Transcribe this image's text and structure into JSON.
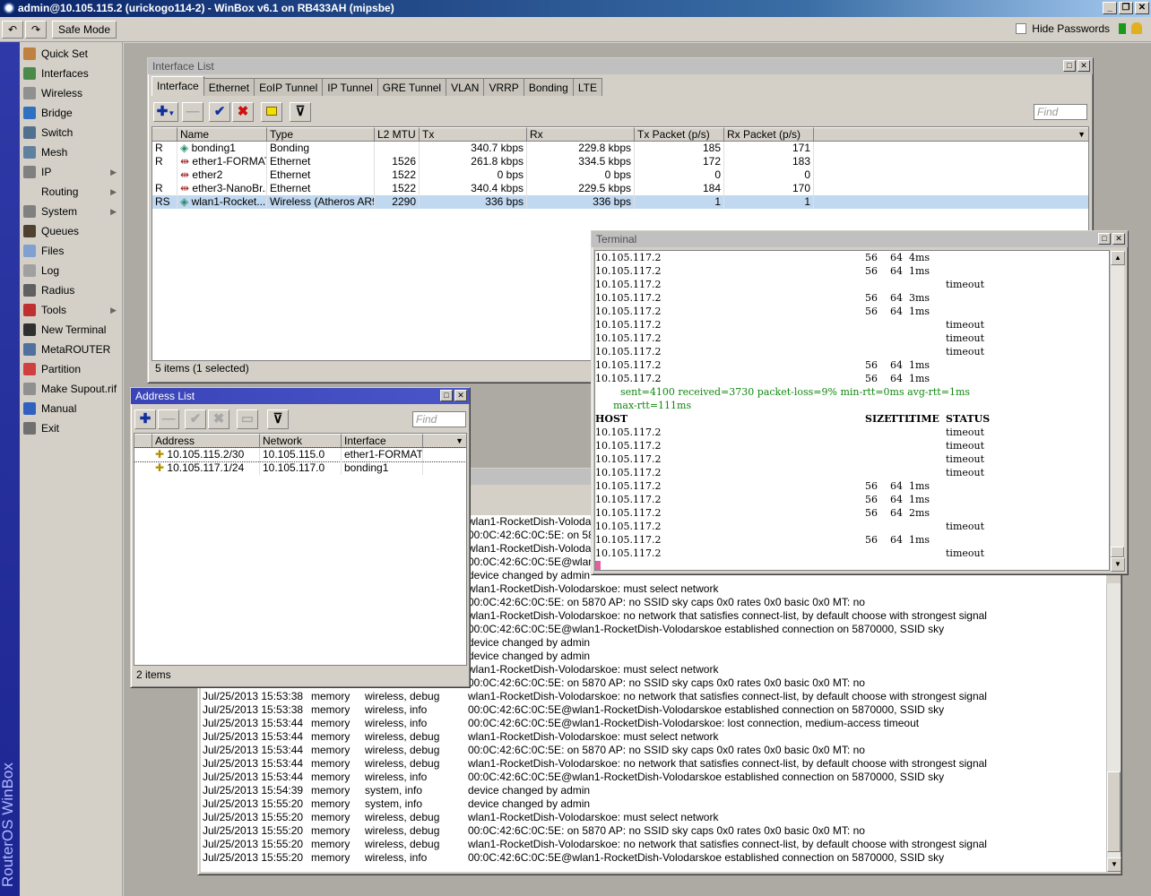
{
  "app": {
    "title": "admin@10.105.115.2 (urickogo114-2) - WinBox v6.1 on RB433AH (mipsbe)",
    "safe_mode": "Safe Mode",
    "hide_passwords": "Hide Passwords",
    "brand": "RouterOS WinBox"
  },
  "menu": [
    {
      "label": "Quick Set",
      "icon": "quick-set-icon",
      "color": "#c08040",
      "arrow": false
    },
    {
      "label": "Interfaces",
      "icon": "interfaces-icon",
      "color": "#4a8a4a",
      "arrow": false
    },
    {
      "label": "Wireless",
      "icon": "wireless-icon",
      "color": "#909090",
      "arrow": false
    },
    {
      "label": "Bridge",
      "icon": "bridge-icon",
      "color": "#3070c0",
      "arrow": false
    },
    {
      "label": "Switch",
      "icon": "switch-icon",
      "color": "#507090",
      "arrow": false
    },
    {
      "label": "Mesh",
      "icon": "mesh-icon",
      "color": "#6080a0",
      "arrow": false
    },
    {
      "label": "IP",
      "icon": "ip-icon",
      "color": "#808080",
      "arrow": true
    },
    {
      "label": "Routing",
      "icon": "",
      "color": "",
      "arrow": true
    },
    {
      "label": "System",
      "icon": "system-icon",
      "color": "#808080",
      "arrow": true
    },
    {
      "label": "Queues",
      "icon": "queues-icon",
      "color": "#504030",
      "arrow": false
    },
    {
      "label": "Files",
      "icon": "files-icon",
      "color": "#80a0d0",
      "arrow": false
    },
    {
      "label": "Log",
      "icon": "log-icon",
      "color": "#a0a0a0",
      "arrow": false
    },
    {
      "label": "Radius",
      "icon": "radius-icon",
      "color": "#606060",
      "arrow": false
    },
    {
      "label": "Tools",
      "icon": "tools-icon",
      "color": "#c03030",
      "arrow": true
    },
    {
      "label": "New Terminal",
      "icon": "terminal-icon",
      "color": "#303030",
      "arrow": false
    },
    {
      "label": "MetaROUTER",
      "icon": "metarouter-icon",
      "color": "#5070a0",
      "arrow": false
    },
    {
      "label": "Partition",
      "icon": "partition-icon",
      "color": "#d04040",
      "arrow": false
    },
    {
      "label": "Make Supout.rif",
      "icon": "supout-icon",
      "color": "#909090",
      "arrow": false
    },
    {
      "label": "Manual",
      "icon": "manual-icon",
      "color": "#3060c0",
      "arrow": false
    },
    {
      "label": "Exit",
      "icon": "exit-icon",
      "color": "#707070",
      "arrow": false
    }
  ],
  "interface_list": {
    "title": "Interface List",
    "tabs": [
      "Interface",
      "Ethernet",
      "EoIP Tunnel",
      "IP Tunnel",
      "GRE Tunnel",
      "VLAN",
      "VRRP",
      "Bonding",
      "LTE"
    ],
    "find_placeholder": "Find",
    "columns": [
      "Name",
      "Type",
      "L2 MTU",
      "Tx",
      "Rx",
      "Tx Packet (p/s)",
      "Rx Packet (p/s)"
    ],
    "rows": [
      {
        "flag": "R",
        "name": "bonding1",
        "type": "Bonding",
        "mtu": "",
        "tx": "340.7 kbps",
        "rx": "229.8 kbps",
        "txp": "185",
        "rxp": "171"
      },
      {
        "flag": "R",
        "name": "ether1-FORMAT",
        "type": "Ethernet",
        "mtu": "1526",
        "tx": "261.8 kbps",
        "rx": "334.5 kbps",
        "txp": "172",
        "rxp": "183"
      },
      {
        "flag": "",
        "name": "ether2",
        "type": "Ethernet",
        "mtu": "1522",
        "tx": "0 bps",
        "rx": "0 bps",
        "txp": "0",
        "rxp": "0"
      },
      {
        "flag": "R",
        "name": "ether3-NanoBr...",
        "type": "Ethernet",
        "mtu": "1522",
        "tx": "340.4 kbps",
        "rx": "229.5 kbps",
        "txp": "184",
        "rxp": "170"
      },
      {
        "flag": "RS",
        "name": "wlan1-Rocket...",
        "type": "Wireless (Atheros AR9...",
        "mtu": "2290",
        "tx": "336 bps",
        "rx": "336 bps",
        "txp": "1",
        "rxp": "1"
      }
    ],
    "status": "5 items (1 selected)"
  },
  "address_list": {
    "title": "Address List",
    "find_placeholder": "Find",
    "columns": [
      "Address",
      "Network",
      "Interface"
    ],
    "rows": [
      {
        "address": "10.105.115.2/30",
        "network": "10.105.115.0",
        "interface": "ether1-FORMAT"
      },
      {
        "address": "10.105.117.1/24",
        "network": "10.105.117.0",
        "interface": "bonding1"
      }
    ],
    "status": "2 items"
  },
  "terminal": {
    "title": "Terminal",
    "lines": [
      {
        "host": "10.105.117.2",
        "size": "56",
        "ttl": "64",
        "time": "4ms",
        "status": ""
      },
      {
        "host": "10.105.117.2",
        "size": "56",
        "ttl": "64",
        "time": "1ms",
        "status": ""
      },
      {
        "host": "10.105.117.2",
        "size": "",
        "ttl": "",
        "time": "",
        "status": "timeout"
      },
      {
        "host": "10.105.117.2",
        "size": "56",
        "ttl": "64",
        "time": "3ms",
        "status": ""
      },
      {
        "host": "10.105.117.2",
        "size": "56",
        "ttl": "64",
        "time": "1ms",
        "status": ""
      },
      {
        "host": "10.105.117.2",
        "size": "",
        "ttl": "",
        "time": "",
        "status": "timeout"
      },
      {
        "host": "10.105.117.2",
        "size": "",
        "ttl": "",
        "time": "",
        "status": "timeout"
      },
      {
        "host": "10.105.117.2",
        "size": "",
        "ttl": "",
        "time": "",
        "status": "timeout"
      },
      {
        "host": "10.105.117.2",
        "size": "56",
        "ttl": "64",
        "time": "1ms",
        "status": ""
      },
      {
        "host": "10.105.117.2",
        "size": "56",
        "ttl": "64",
        "time": "1ms",
        "status": ""
      }
    ],
    "summary1": "sent=4100 received=3730 packet-loss=9% min-rtt=0ms avg-rtt=1ms",
    "summary2": "max-rtt=111ms",
    "header": {
      "host": "HOST",
      "size": "SIZE",
      "ttl": "TTL",
      "time": "TIME",
      "status": "STATUS"
    },
    "lines2": [
      {
        "host": "10.105.117.2",
        "size": "",
        "ttl": "",
        "time": "",
        "status": "timeout"
      },
      {
        "host": "10.105.117.2",
        "size": "",
        "ttl": "",
        "time": "",
        "status": "timeout"
      },
      {
        "host": "10.105.117.2",
        "size": "",
        "ttl": "",
        "time": "",
        "status": "timeout"
      },
      {
        "host": "10.105.117.2",
        "size": "",
        "ttl": "",
        "time": "",
        "status": "timeout"
      },
      {
        "host": "10.105.117.2",
        "size": "56",
        "ttl": "64",
        "time": "1ms",
        "status": ""
      },
      {
        "host": "10.105.117.2",
        "size": "56",
        "ttl": "64",
        "time": "1ms",
        "status": ""
      },
      {
        "host": "10.105.117.2",
        "size": "56",
        "ttl": "64",
        "time": "2ms",
        "status": ""
      },
      {
        "host": "10.105.117.2",
        "size": "",
        "ttl": "",
        "time": "",
        "status": "timeout"
      },
      {
        "host": "10.105.117.2",
        "size": "56",
        "ttl": "64",
        "time": "1ms",
        "status": ""
      },
      {
        "host": "10.105.117.2",
        "size": "",
        "ttl": "",
        "time": "",
        "status": "timeout"
      }
    ]
  },
  "log": {
    "partial_rows": [
      "wlan1-RocketDish-Volodarskoe",
      "00:0C:42:6C:0C:5E: on 5870",
      "wlan1-RocketDish-Volodarskoe",
      "00:0C:42:6C:0C:5E@wlan1-R",
      "device changed by admin",
      "wlan1-RocketDish-Volodarskoe: must select network",
      "00:0C:42:6C:0C:5E: on 5870 AP: no SSID sky caps 0x0 rates 0x0 basic 0x0 MT: no",
      "wlan1-RocketDish-Volodarskoe: no network that satisfies connect-list,  by default choose with strongest signal",
      "00:0C:42:6C:0C:5E@wlan1-RocketDish-Volodarskoe established connection on 5870000, SSID sky",
      "device changed by admin",
      "device changed by admin",
      "wlan1-RocketDish-Volodarskoe: must select network",
      "00:0C:42:6C:0C:5E: on 5870 AP: no SSID sky caps 0x0 rates 0x0 basic 0x0 MT: no"
    ],
    "rows": [
      {
        "time": "Jul/25/2013 15:53:38",
        "buffer": "memory",
        "topics": "wireless, debug",
        "message": "wlan1-RocketDish-Volodarskoe: no network that satisfies connect-list,  by default choose with strongest signal"
      },
      {
        "time": "Jul/25/2013 15:53:38",
        "buffer": "memory",
        "topics": "wireless, info",
        "message": "00:0C:42:6C:0C:5E@wlan1-RocketDish-Volodarskoe established connection on 5870000, SSID sky"
      },
      {
        "time": "Jul/25/2013 15:53:44",
        "buffer": "memory",
        "topics": "wireless, info",
        "message": "00:0C:42:6C:0C:5E@wlan1-RocketDish-Volodarskoe: lost connection, medium-access timeout"
      },
      {
        "time": "Jul/25/2013 15:53:44",
        "buffer": "memory",
        "topics": "wireless, debug",
        "message": "wlan1-RocketDish-Volodarskoe: must select network"
      },
      {
        "time": "Jul/25/2013 15:53:44",
        "buffer": "memory",
        "topics": "wireless, debug",
        "message": "00:0C:42:6C:0C:5E: on 5870 AP: no SSID sky caps 0x0 rates 0x0 basic 0x0 MT: no"
      },
      {
        "time": "Jul/25/2013 15:53:44",
        "buffer": "memory",
        "topics": "wireless, debug",
        "message": "wlan1-RocketDish-Volodarskoe: no network that satisfies connect-list,  by default choose with strongest signal"
      },
      {
        "time": "Jul/25/2013 15:53:44",
        "buffer": "memory",
        "topics": "wireless, info",
        "message": "00:0C:42:6C:0C:5E@wlan1-RocketDish-Volodarskoe established connection on 5870000, SSID sky"
      },
      {
        "time": "Jul/25/2013 15:54:39",
        "buffer": "memory",
        "topics": "system, info",
        "message": "device changed by admin"
      },
      {
        "time": "Jul/25/2013 15:55:20",
        "buffer": "memory",
        "topics": "system, info",
        "message": "device changed by admin"
      },
      {
        "time": "Jul/25/2013 15:55:20",
        "buffer": "memory",
        "topics": "wireless, debug",
        "message": "wlan1-RocketDish-Volodarskoe: must select network"
      },
      {
        "time": "Jul/25/2013 15:55:20",
        "buffer": "memory",
        "topics": "wireless, debug",
        "message": "00:0C:42:6C:0C:5E: on 5870 AP: no SSID sky caps 0x0 rates 0x0 basic 0x0 MT: no"
      },
      {
        "time": "Jul/25/2013 15:55:20",
        "buffer": "memory",
        "topics": "wireless, debug",
        "message": "wlan1-RocketDish-Volodarskoe: no network that satisfies connect-list,  by default choose with strongest signal"
      },
      {
        "time": "Jul/25/2013 15:55:20",
        "buffer": "memory",
        "topics": "wireless, info",
        "message": "00:0C:42:6C:0C:5E@wlan1-RocketDish-Volodarskoe established connection on 5870000, SSID sky"
      }
    ]
  }
}
